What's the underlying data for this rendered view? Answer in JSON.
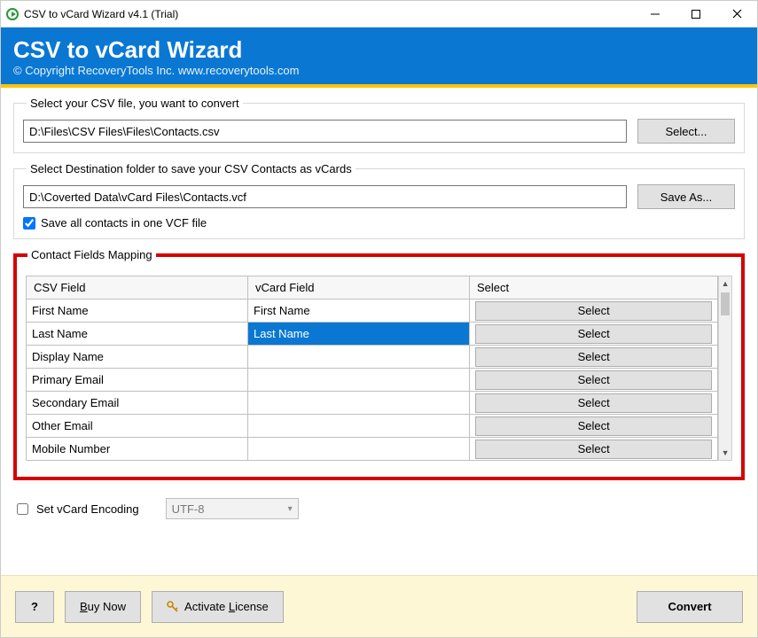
{
  "window": {
    "title": "CSV to vCard Wizard v4.1 (Trial)"
  },
  "banner": {
    "title": "CSV to vCard Wizard",
    "subtitle": "© Copyright RecoveryTools Inc. www.recoverytools.com"
  },
  "source": {
    "legend": "Select your CSV file, you want to convert",
    "path": "D:\\Files\\CSV Files\\Files\\Contacts.csv",
    "button": "Select..."
  },
  "dest": {
    "legend": "Select Destination folder to save your CSV Contacts as vCards",
    "path": "D:\\Coverted Data\\vCard Files\\Contacts.vcf",
    "button": "Save As...",
    "save_all_label": "Save all contacts in one VCF file",
    "save_all_checked": true
  },
  "mapping": {
    "legend": "Contact Fields Mapping",
    "headers": {
      "csv": "CSV Field",
      "vcard": "vCard Field",
      "select": "Select"
    },
    "select_btn": "Select",
    "rows": [
      {
        "csv": "First Name",
        "vcard": "First Name",
        "selected": false
      },
      {
        "csv": "Last Name",
        "vcard": "Last Name",
        "selected": true
      },
      {
        "csv": "Display Name",
        "vcard": "",
        "selected": false
      },
      {
        "csv": "Primary Email",
        "vcard": "",
        "selected": false
      },
      {
        "csv": "Secondary Email",
        "vcard": "",
        "selected": false
      },
      {
        "csv": "Other Email",
        "vcard": "",
        "selected": false
      },
      {
        "csv": "Mobile Number",
        "vcard": "",
        "selected": false
      }
    ]
  },
  "encoding": {
    "label": "Set vCard Encoding",
    "checked": false,
    "value": "UTF-8"
  },
  "footer": {
    "help": "?",
    "buy_u": "B",
    "buy_rest": "uy Now",
    "activate_u": "L",
    "activate_before": "Activate ",
    "activate_after": "icense",
    "convert": "Convert"
  }
}
